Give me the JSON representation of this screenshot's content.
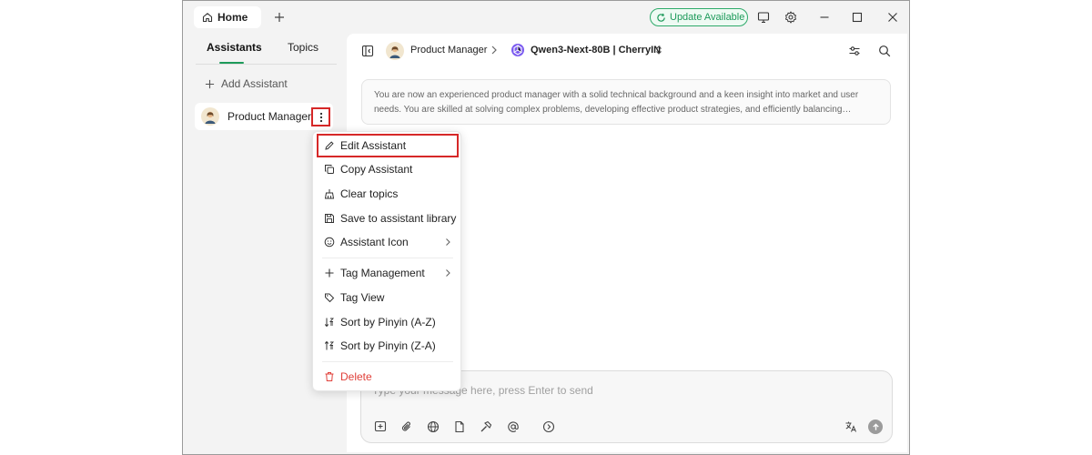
{
  "titlebar": {
    "home_tab": "Home",
    "update_label": "Update Available"
  },
  "sidebar": {
    "tabs": [
      "Assistants",
      "Topics"
    ],
    "add_assistant": "Add Assistant",
    "assistant_name": "Product Manager"
  },
  "context_menu": {
    "items": [
      {
        "label": "Edit Assistant",
        "icon": "pencil-icon"
      },
      {
        "label": "Copy Assistant",
        "icon": "copy-icon"
      },
      {
        "label": "Clear topics",
        "icon": "broom-icon"
      },
      {
        "label": "Save to assistant library",
        "icon": "save-icon"
      },
      {
        "label": "Assistant Icon",
        "icon": "smiley-icon",
        "submenu": true
      },
      {
        "label": "Tag Management",
        "icon": "plus-icon",
        "submenu": true
      },
      {
        "label": "Tag View",
        "icon": "tags-icon"
      },
      {
        "label": "Sort by Pinyin (A-Z)",
        "icon": "sort-asc-icon"
      },
      {
        "label": "Sort by Pinyin (Z-A)",
        "icon": "sort-desc-icon"
      },
      {
        "label": "Delete",
        "icon": "trash-icon",
        "danger": true
      }
    ]
  },
  "main": {
    "assistant_name": "Product Manager",
    "model_name": "Qwen3-Next-80B | CherryIN",
    "prompt_line1": "You are now an experienced product manager with a solid technical background and a keen insight into market and user",
    "prompt_line2": "needs. You are skilled at solving complex problems, developing effective product strategies, and efficiently balancing…",
    "input_placeholder": "Type your message here, press Enter to send"
  },
  "colors": {
    "accent": "#1d9a5a",
    "danger": "#e0403a",
    "highlight_border": "#d62828"
  }
}
